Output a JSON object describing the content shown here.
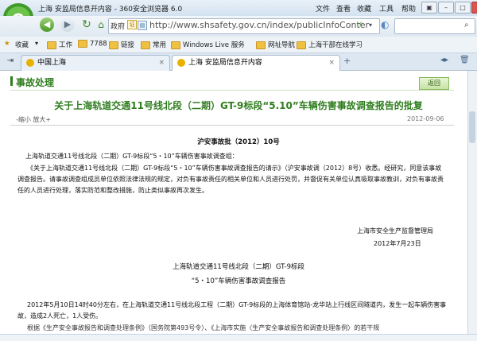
{
  "window": {
    "title": "上海 安监局信息开内容 - 360安全浏览器 6.0",
    "menu": [
      "文件",
      "查看",
      "收藏",
      "工具",
      "帮助"
    ]
  },
  "nav": {
    "gov_badge": "政府",
    "url": "http://www.shsafety.gov.cn/index/publicInfoConter"
  },
  "favorites": {
    "label": "收藏",
    "items": [
      "工作",
      "7788",
      "链接",
      "常用",
      "Windows Live 服务",
      "网址导航",
      "上海干部在线学习"
    ]
  },
  "tabs": [
    {
      "label": "中国上海"
    },
    {
      "label": "上海 安监局信息开内容"
    }
  ],
  "page": {
    "section_title": "事故处理",
    "back_label": "返回",
    "article_title": "关于上海轨道交通11号线北段（二期）GT-9标段“5.10”车辆伤害事故调查报告的批复",
    "font_tools": "-缩小  放大+",
    "date_top": "2012-09-06",
    "doc_no": "沪安事故批（2012）10号",
    "addressee": "上海轨道交通11号线北段（二期）GT-9标段“5・10”车辆伤害事故调查组：",
    "para1": "《关于上海轨道交通11号线北段（二期）GT-9标段“5・10”车辆伤害事故调查报告的请示》（沪安事故调（2012）8号）收悉。经研究，同意该事故调查报告。请事故调查组成员单位依照法律法规的规定，对负有事故责任的相关单位和人员进行处罚，并督促有关单位认真吸取事故教训，对负有事故责任的人员进行处理，落实防范和整改措施，防止类似事故再次发生。",
    "sig_org": "上海市安全生产监督管理局",
    "sig_date": "2012年7月23日",
    "report_title_1": "上海轨道交通11号线北段（二期）GT-9标段",
    "report_title_2": "“5・10”车辆伤害事故调查报告",
    "para2": "2012年5月10日14时40分左右，在上海轨道交通11号线北段工程（二期）GT-9标段的上海体育馆站-龙华站上行线区间隧道内，发生一起车辆伤害事故，造成2人死亡，1人受伤。",
    "para3": "根据《生产安全事故报告和调查处理条例》（国务院第493号令）、《上海市实施〈生产安全事故报告和调查处理条例〉的若干规"
  }
}
